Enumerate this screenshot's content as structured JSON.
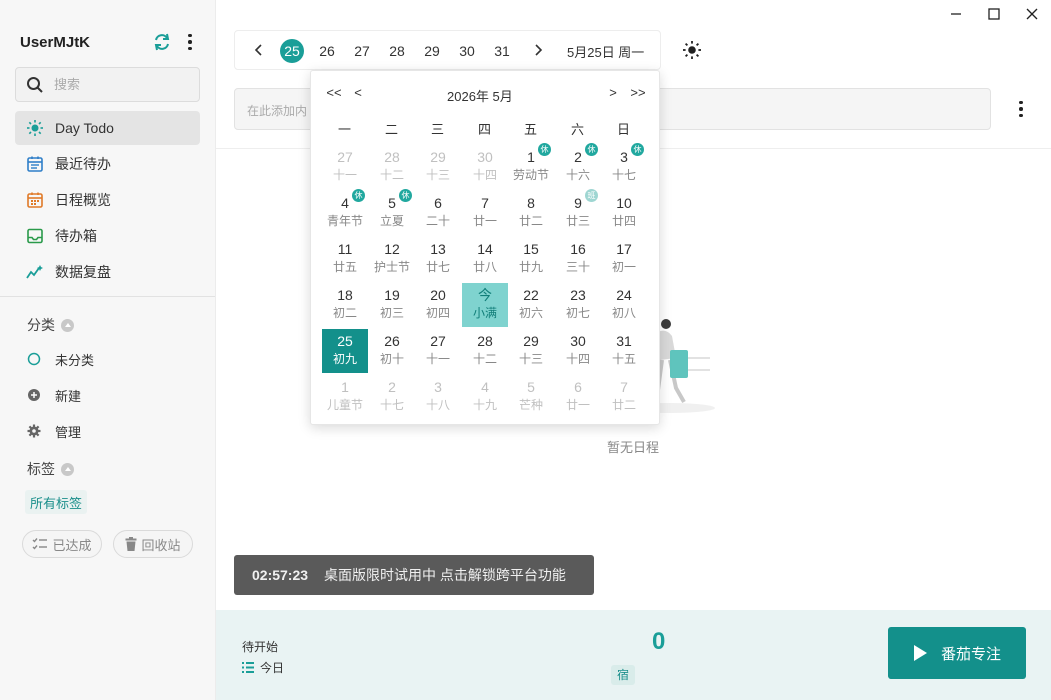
{
  "sidebar": {
    "username": "UserMJtK",
    "search_placeholder": "搜索",
    "nav": [
      {
        "label": "Day Todo",
        "icon": "sun-icon"
      },
      {
        "label": "最近待办",
        "icon": "calendar-list-icon"
      },
      {
        "label": "日程概览",
        "icon": "calendar-grid-icon"
      },
      {
        "label": "待办箱",
        "icon": "inbox-icon"
      },
      {
        "label": "数据复盘",
        "icon": "stats-icon"
      }
    ],
    "category_title": "分类",
    "categories": [
      {
        "label": "未分类",
        "icon": "circle-icon"
      },
      {
        "label": "新建",
        "icon": "plus-circle-icon"
      },
      {
        "label": "管理",
        "icon": "gear-icon"
      }
    ],
    "tag_title": "标签",
    "all_tags": "所有标签",
    "done_button": "已达成",
    "trash_button": "回收站"
  },
  "datebar": {
    "days": [
      "25",
      "26",
      "27",
      "28",
      "29",
      "30",
      "31"
    ],
    "selected_day": "25",
    "label": "5月25日 周一"
  },
  "add_input_placeholder": "在此添加内",
  "empty_text": "暂无日程",
  "calendar": {
    "prev_year": "<<",
    "prev_month": "<",
    "next_month": ">",
    "next_year": ">>",
    "title": "2026年  5月",
    "weekdays": [
      "一",
      "二",
      "三",
      "四",
      "五",
      "六",
      "日"
    ],
    "rows": [
      [
        {
          "d": "27",
          "l": "十一",
          "other": true
        },
        {
          "d": "28",
          "l": "十二",
          "other": true
        },
        {
          "d": "29",
          "l": "十三",
          "other": true
        },
        {
          "d": "30",
          "l": "十四",
          "other": true
        },
        {
          "d": "1",
          "l": "劳动节",
          "badge": "休"
        },
        {
          "d": "2",
          "l": "十六",
          "badge": "休"
        },
        {
          "d": "3",
          "l": "十七",
          "badge": "休"
        }
      ],
      [
        {
          "d": "4",
          "l": "青年节",
          "badge": "休"
        },
        {
          "d": "5",
          "l": "立夏",
          "badge": "休"
        },
        {
          "d": "6",
          "l": "二十"
        },
        {
          "d": "7",
          "l": "廿一"
        },
        {
          "d": "8",
          "l": "廿二"
        },
        {
          "d": "9",
          "l": "廿三",
          "badge": "班",
          "work": true
        },
        {
          "d": "10",
          "l": "廿四"
        }
      ],
      [
        {
          "d": "11",
          "l": "廿五"
        },
        {
          "d": "12",
          "l": "护士节"
        },
        {
          "d": "13",
          "l": "廿七"
        },
        {
          "d": "14",
          "l": "廿八"
        },
        {
          "d": "15",
          "l": "廿九"
        },
        {
          "d": "16",
          "l": "三十"
        },
        {
          "d": "17",
          "l": "初一"
        }
      ],
      [
        {
          "d": "18",
          "l": "初二"
        },
        {
          "d": "19",
          "l": "初三"
        },
        {
          "d": "20",
          "l": "初四"
        },
        {
          "d": "今",
          "l": "小满",
          "today": true
        },
        {
          "d": "22",
          "l": "初六"
        },
        {
          "d": "23",
          "l": "初七"
        },
        {
          "d": "24",
          "l": "初八"
        }
      ],
      [
        {
          "d": "25",
          "l": "初九",
          "selected": true
        },
        {
          "d": "26",
          "l": "初十"
        },
        {
          "d": "27",
          "l": "十一"
        },
        {
          "d": "28",
          "l": "十二"
        },
        {
          "d": "29",
          "l": "十三"
        },
        {
          "d": "30",
          "l": "十四"
        },
        {
          "d": "31",
          "l": "十五"
        }
      ],
      [
        {
          "d": "1",
          "l": "儿童节",
          "other": true
        },
        {
          "d": "2",
          "l": "十七",
          "other": true
        },
        {
          "d": "3",
          "l": "十八",
          "other": true
        },
        {
          "d": "4",
          "l": "十九",
          "other": true
        },
        {
          "d": "5",
          "l": "芒种",
          "other": true
        },
        {
          "d": "6",
          "l": "廿一",
          "other": true
        },
        {
          "d": "7",
          "l": "廿二",
          "other": true
        }
      ]
    ]
  },
  "toast": {
    "time": "02:57:23",
    "message": "桌面版限时试用中  点击解锁跨平台功能"
  },
  "footer": {
    "pending_label": "待开始",
    "pending_count": "0",
    "today_label": "今日",
    "chip": "宿",
    "button_label": "番茄专注"
  },
  "colors": {
    "accent": "#1a9e98",
    "selected": "#13908b",
    "today": "#7fd3cf"
  }
}
